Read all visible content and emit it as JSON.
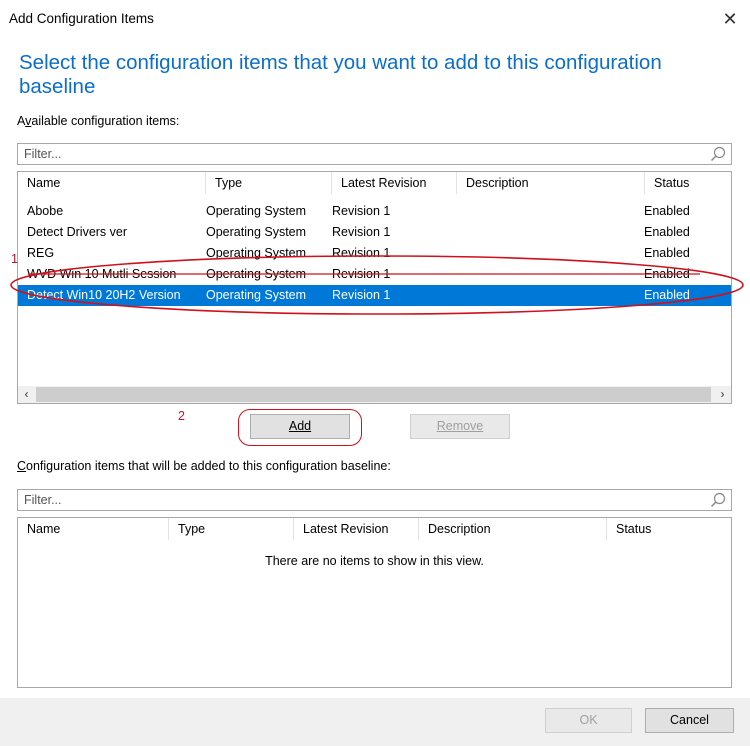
{
  "window": {
    "title": "Add Configuration Items",
    "close_glyph": "✕"
  },
  "instruction": "Select the configuration items that you want to add to this configuration baseline",
  "available": {
    "label": "Available configuration items:",
    "filter_placeholder": "Filter...",
    "columns": [
      "Name",
      "Type",
      "Latest Revision",
      "Description",
      "Status"
    ],
    "rows": [
      {
        "name": "Abobe",
        "type": "Operating System",
        "revision": "Revision 1",
        "description": "",
        "status": "Enabled"
      },
      {
        "name": "Detect Drivers ver",
        "type": "Operating System",
        "revision": "Revision 1",
        "description": "",
        "status": "Enabled"
      },
      {
        "name": "REG",
        "type": "Operating System",
        "revision": "Revision 1",
        "description": "",
        "status": "Enabled"
      },
      {
        "name": "WVD Win 10 Mutli Session",
        "type": "Operating System",
        "revision": "Revision 1",
        "description": "",
        "status": "Enabled"
      },
      {
        "name": "Detect Win10 20H2 Version",
        "type": "Operating System",
        "revision": "Revision 1",
        "description": "",
        "status": "Enabled"
      }
    ],
    "selected_row": "Detect Win10 20H2 Version"
  },
  "buttons": {
    "add": "Add",
    "remove": "Remove",
    "ok": "OK",
    "cancel": "Cancel"
  },
  "selected_section": {
    "label": "Configuration items that will be added to this configuration baseline:",
    "filter_placeholder": "Filter...",
    "columns": [
      "Name",
      "Type",
      "Latest Revision",
      "Description",
      "Status"
    ],
    "empty_message": "There are no items to show in this view."
  },
  "annotations": {
    "step1": "1",
    "step2": "2"
  },
  "icons": {
    "search": "search-icon",
    "scroll_left": "‹",
    "scroll_right": "›"
  },
  "colors": {
    "accent": "#0b6ec9",
    "selection": "#0078d7",
    "annotation": "#d0101c"
  }
}
